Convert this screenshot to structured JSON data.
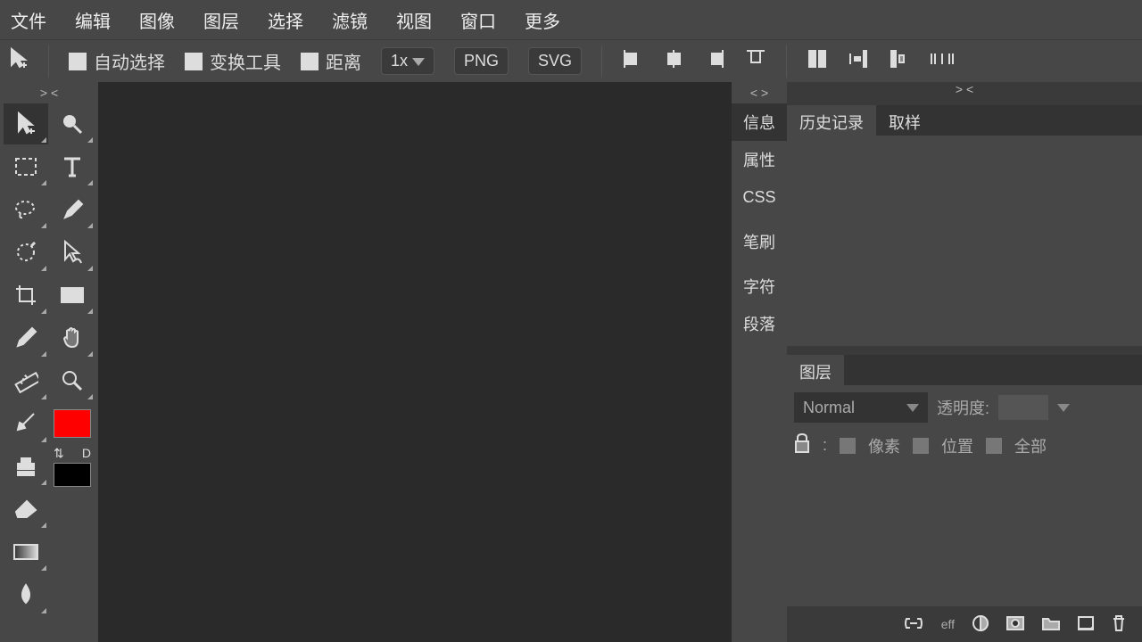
{
  "menu": [
    "文件",
    "编辑",
    "图像",
    "图层",
    "选择",
    "滤镜",
    "视图",
    "窗口",
    "更多"
  ],
  "opt": {
    "autoselect": "自动选择",
    "transform": "变换工具",
    "distance": "距离",
    "zoom": "1x",
    "png": "PNG",
    "svg": "SVG"
  },
  "tool_dock_header": "> <",
  "sidebar_tabs_header": "< >",
  "right_header": "> <",
  "sidebar_tabs": [
    "信息",
    "属性",
    "CSS",
    "笔刷",
    "字符",
    "段落"
  ],
  "history_tabs": {
    "history": "历史记录",
    "sample": "取样"
  },
  "layers_panel": {
    "title": "图层",
    "blend": "Normal",
    "opacity_label": "透明度:",
    "lock": "",
    "pixels": "像素",
    "position": "位置",
    "all": "全部"
  },
  "swap_label": "⇅",
  "default_label": "D",
  "eff": "eff"
}
